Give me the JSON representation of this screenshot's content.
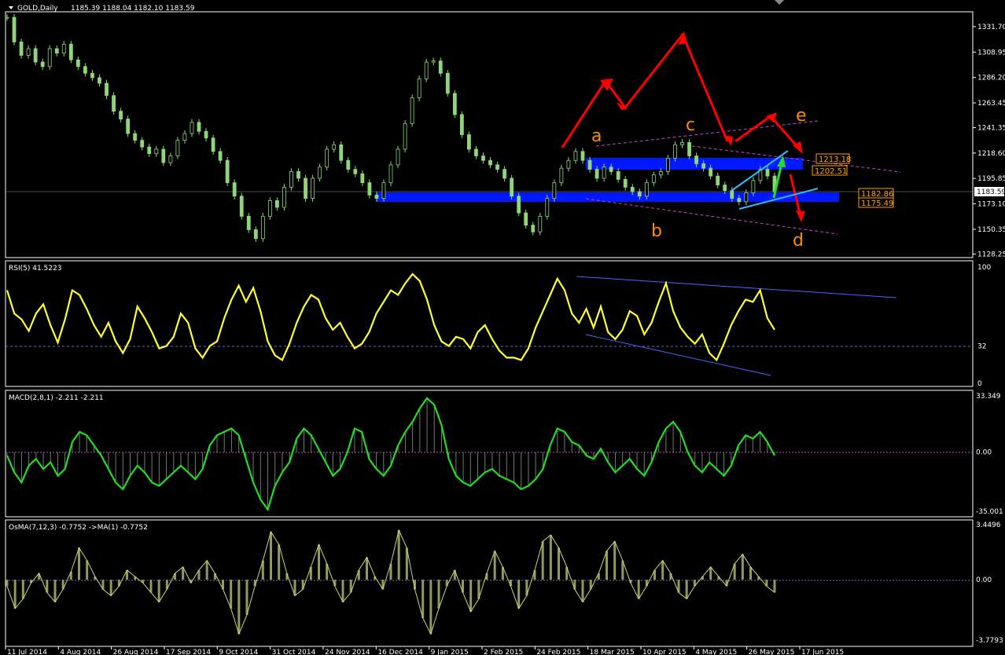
{
  "chart_data": [
    {
      "type": "candlestick",
      "title": "GOLD,Daily",
      "ohlc_label": "1185.39 1188.04 1182.10 1183.59",
      "y_ticks": [
        "1331.70",
        "1308.95",
        "1286.20",
        "1263.45",
        "1241.35",
        "1218.60",
        "1195.85",
        "1173.10",
        "1150.35",
        "1128.25"
      ],
      "y_range": [
        1125,
        1345
      ],
      "current_price": "1183.59",
      "price_tags": [
        "1213.18",
        "1202.51",
        "1182.86",
        "1175.49"
      ],
      "wave_labels": [
        "a",
        "b",
        "c",
        "d",
        "e"
      ],
      "close_series": [
        1340,
        1318,
        1306,
        1312,
        1300,
        1296,
        1312,
        1308,
        1316,
        1302,
        1296,
        1290,
        1286,
        1281,
        1270,
        1256,
        1249,
        1236,
        1230,
        1224,
        1218,
        1222,
        1210,
        1216,
        1230,
        1236,
        1246,
        1238,
        1232,
        1220,
        1212,
        1192,
        1180,
        1162,
        1150,
        1142,
        1162,
        1176,
        1170,
        1188,
        1202,
        1196,
        1178,
        1196,
        1206,
        1222,
        1226,
        1212,
        1204,
        1200,
        1192,
        1181,
        1178,
        1192,
        1208,
        1222,
        1245,
        1268,
        1285,
        1300,
        1301,
        1290,
        1272,
        1253,
        1235,
        1222,
        1216,
        1212,
        1208,
        1204,
        1196,
        1180,
        1165,
        1154,
        1148,
        1162,
        1178,
        1192,
        1205,
        1212,
        1220,
        1212,
        1204,
        1196,
        1206,
        1202,
        1195,
        1188,
        1184,
        1180,
        1192,
        1199,
        1202,
        1214,
        1226,
        1228,
        1216,
        1209,
        1205,
        1198,
        1190,
        1185,
        1178,
        1175,
        1183,
        1194,
        1204,
        1198,
        1184
      ]
    },
    {
      "type": "line",
      "label": "RSI(5) 41.5223",
      "y_ticks": [
        "100",
        "32",
        "0"
      ],
      "y_range": [
        0,
        100
      ],
      "level": 32,
      "values": [
        80,
        60,
        55,
        45,
        60,
        68,
        50,
        35,
        55,
        80,
        76,
        64,
        50,
        40,
        52,
        36,
        26,
        38,
        66,
        56,
        44,
        30,
        32,
        40,
        60,
        52,
        30,
        22,
        32,
        36,
        56,
        72,
        84,
        70,
        82,
        62,
        36,
        24,
        20,
        34,
        52,
        66,
        76,
        72,
        56,
        46,
        52,
        40,
        30,
        34,
        44,
        60,
        70,
        80,
        76,
        86,
        94,
        88,
        72,
        50,
        36,
        32,
        40,
        38,
        30,
        44,
        50,
        38,
        28,
        22,
        22,
        20,
        30,
        48,
        62,
        76,
        90,
        80,
        60,
        52,
        64,
        48,
        66,
        44,
        38,
        46,
        62,
        58,
        42,
        52,
        70,
        86,
        62,
        48,
        40,
        34,
        42,
        26,
        20,
        34,
        50,
        62,
        72,
        70,
        80,
        56,
        46
      ]
    },
    {
      "type": "line",
      "label": "MACD(2,8,1) -2.211 -2.211",
      "y_ticks": [
        "33.349",
        "0.00",
        "-35.001"
      ],
      "y_range": [
        -35.001,
        33.349
      ],
      "values": [
        -2,
        -12,
        -18,
        -8,
        -4,
        -10,
        -6,
        -14,
        -10,
        6,
        12,
        10,
        4,
        -2,
        -10,
        -18,
        -22,
        -14,
        -8,
        -12,
        -18,
        -20,
        -16,
        -12,
        -8,
        -12,
        -16,
        -10,
        4,
        10,
        12,
        14,
        10,
        -4,
        -18,
        -28,
        -34,
        -20,
        -12,
        -6,
        8,
        14,
        10,
        2,
        -6,
        -14,
        -10,
        0,
        14,
        12,
        -4,
        -10,
        -14,
        -8,
        4,
        12,
        18,
        26,
        32,
        28,
        16,
        -4,
        -14,
        -18,
        -20,
        -16,
        -12,
        -10,
        -14,
        -16,
        -18,
        -22,
        -20,
        -16,
        -10,
        4,
        14,
        12,
        6,
        4,
        -2,
        -4,
        2,
        -6,
        -12,
        -8,
        -4,
        -10,
        -14,
        -6,
        6,
        14,
        18,
        12,
        0,
        -8,
        -12,
        -6,
        -10,
        -14,
        -8,
        4,
        10,
        8,
        12,
        6,
        -2
      ]
    },
    {
      "type": "bar",
      "label": "OsMA(7,12,3) -0.7752   ->MA(1) -0.7752",
      "y_ticks": [
        "3.4496",
        "0.00",
        "-3.7793"
      ],
      "y_range": [
        -3.7793,
        3.4496
      ],
      "values": [
        -0.4,
        -1.8,
        -1.2,
        -0.2,
        0.4,
        -0.8,
        -1.4,
        -0.6,
        0.5,
        2.0,
        1.2,
        0.2,
        -0.6,
        -1.0,
        -0.4,
        0.6,
        0.2,
        -0.2,
        -0.8,
        -1.4,
        -0.6,
        0.4,
        0.8,
        -0.2,
        0.6,
        1.2,
        0.4,
        -0.6,
        -1.8,
        -3.4,
        -2.2,
        -0.4,
        1.2,
        3.0,
        2.2,
        0.4,
        -1.0,
        -0.6,
        0.8,
        2.2,
        1.0,
        -0.4,
        -1.4,
        -0.8,
        0.6,
        1.4,
        0.2,
        -0.6,
        1.0,
        3.1,
        2.0,
        -0.6,
        -2.4,
        -3.4,
        -1.8,
        -0.4,
        0.6,
        -0.8,
        -2.0,
        -1.2,
        0.4,
        1.8,
        0.8,
        -0.4,
        -1.8,
        -1.0,
        0.6,
        2.4,
        2.8,
        2.0,
        0.8,
        -0.6,
        -1.4,
        -0.6,
        0.4,
        1.8,
        2.4,
        1.2,
        -0.2,
        -1.2,
        -0.4,
        0.6,
        1.2,
        0.4,
        -0.8,
        -1.2,
        -0.4,
        0.2,
        0.8,
        0.2,
        -0.4,
        1.0,
        1.6,
        0.8,
        0.2,
        -0.4,
        -0.8
      ]
    }
  ],
  "x_labels": [
    "11 Jul 2014",
    "4 Aug 2014",
    "26 Aug 2014",
    "17 Sep 2014",
    "9 Oct 2014",
    "31 Oct 2014",
    "24 Nov 2014",
    "16 Dec 2014",
    "9 Jan 2015",
    "2 Feb 2015",
    "24 Feb 2015",
    "18 Mar 2015",
    "10 Apr 2015",
    "4 May 2015",
    "26 May 2015",
    "17 Jun 2015"
  ],
  "colors": {
    "background": "#000000",
    "grid": "#ffffff",
    "candle": "#8fd67a",
    "rsi": "#ffff33",
    "macd": "#22dd22",
    "osma": "#8e9a5e",
    "zone": "#0018ff",
    "arrows": "#ff0000",
    "channel": "#cc44cc",
    "trend": "#1e90ff",
    "labels": "#ff8c00"
  }
}
